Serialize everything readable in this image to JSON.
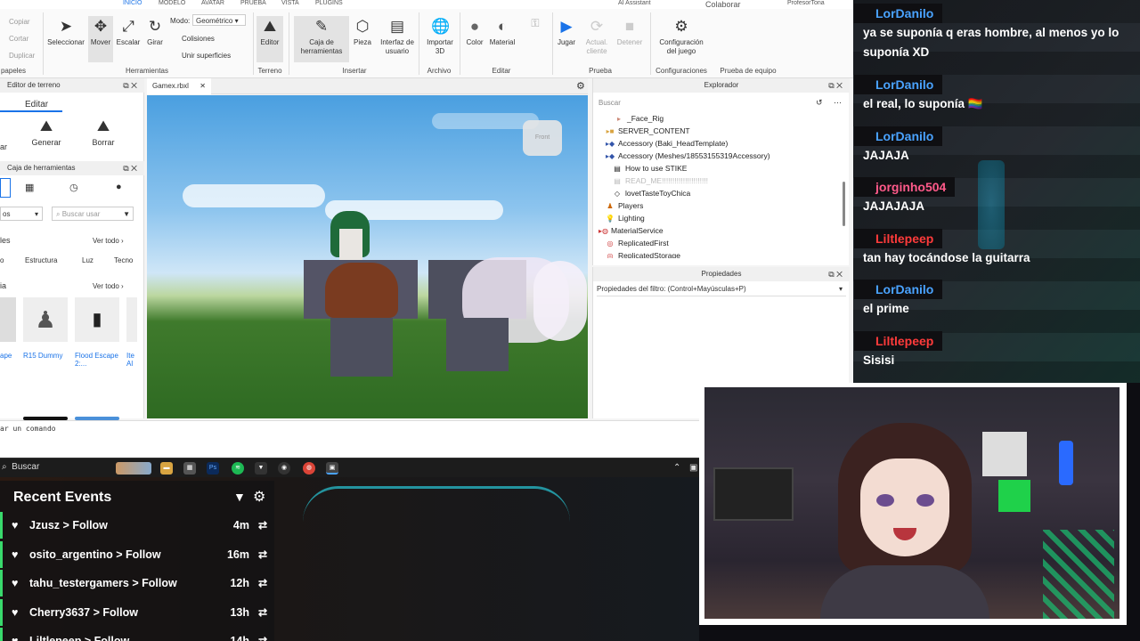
{
  "menubar": {
    "items": [
      "INICIO",
      "MODELO",
      "AVATAR",
      "PRUEBA",
      "VISTA",
      "PLUGINS"
    ],
    "assistant": "AI Assistant",
    "collaborate": "Colaborar",
    "user": "ProfesorTona"
  },
  "ribbon": {
    "clipboard": [
      "Copiar",
      "Cortar",
      "Duplicar"
    ],
    "clipboard_group": "papeles",
    "tools": [
      "Seleccionar",
      "Mover",
      "Escalar",
      "Girar"
    ],
    "mode_label": "Modo:",
    "mode_value": "Geométrico",
    "collisions": "Colisiones",
    "join": "Unir superficies",
    "tools_group": "Herramientas",
    "editor": "Editor",
    "terrain_group": "Terreno",
    "toolbox": "Caja de herramientas",
    "part": "Pieza",
    "ui": "Interfaz de usuario",
    "insert_group": "Insertar",
    "import3d": "Importar 3D",
    "file_group": "Archivo",
    "color": "Color",
    "material": "Material",
    "edit_group": "Editar",
    "play": "Jugar",
    "update_client": "Actual. cliente",
    "stop": "Detener",
    "test_group": "Prueba",
    "game_settings": "Configuración del juego",
    "settings_group": "Configuraciones",
    "team_test_group": "Prueba de equipo"
  },
  "terrain_panel": {
    "title": "Editor de terreno",
    "tab": "Editar",
    "generate": "Generar",
    "erase": "Borrar",
    "left_clip": "ar"
  },
  "toolbox_panel": {
    "title": "Caja de herramientas",
    "dropdown": "os",
    "search_placeholder": "Buscar usar",
    "section1": "les",
    "see_all": "Ver todo",
    "chips": [
      "o",
      "Estructura",
      "Luz",
      "Tecno"
    ],
    "section2": "ia",
    "items": [
      "ape",
      "R15 Dummy",
      "Flood Escape 2:...",
      "Ite Al"
    ]
  },
  "viewport": {
    "tab": "Gamex.rbxl",
    "front_label": "Front"
  },
  "explorer": {
    "title": "Explorador",
    "search": "Buscar",
    "rows": [
      "_Face_Rig",
      "SERVER_CONTENT",
      "Accessory (Baki_HeadTemplate)",
      "Accessory (Meshes/18553155319Accessory)",
      "How to use STIKE",
      "READ_ME!!!!!!!!!!!!!!!!!!!!!!",
      "lovetTasteToyChica",
      "Players",
      "Lighting",
      "MaterialService",
      "ReplicatedFirst",
      "ReplicatedStorage"
    ]
  },
  "properties": {
    "title": "Propiedades",
    "filter": "Propiedades del filtro: (Control+Mayúsculas+P)"
  },
  "command_bar": {
    "text": "ar un comando"
  },
  "taskbar": {
    "search": "Buscar"
  },
  "recent_events": {
    "title": "Recent Events",
    "events": [
      {
        "user": "Jzusz",
        "action": "Follow",
        "time": "4m"
      },
      {
        "user": "osito_argentino",
        "action": "Follow",
        "time": "16m"
      },
      {
        "user": "tahu_testergamers",
        "action": "Follow",
        "time": "12h"
      },
      {
        "user": "Cherry3637",
        "action": "Follow",
        "time": "13h"
      },
      {
        "user": "Liltlepeep",
        "action": "Follow",
        "time": "14h"
      }
    ]
  },
  "chat": {
    "messages": [
      {
        "name": "LorDanilo",
        "color": "#4aa3ff",
        "text": "ya se suponía q eras hombre, al menos yo lo suponía XD"
      },
      {
        "name": "LorDanilo",
        "color": "#4aa3ff",
        "text": "el real, lo suponía 🏳️‍🌈"
      },
      {
        "name": "LorDanilo",
        "color": "#4aa3ff",
        "text": "JAJAJA"
      },
      {
        "name": "jorginho504",
        "color": "#ff5a8a",
        "text": "JAJAJAJA"
      },
      {
        "name": "Liltlepeep",
        "color": "#ff3b3b",
        "text": "tan hay tocándose la guitarra"
      },
      {
        "name": "LorDanilo",
        "color": "#4aa3ff",
        "text": "el prime"
      },
      {
        "name": "Liltlepeep",
        "color": "#ff3b3b",
        "text": "Sisisi"
      }
    ]
  },
  "colors": {
    "accent_green": "#39d96c",
    "studio_blue": "#1a73e8"
  }
}
